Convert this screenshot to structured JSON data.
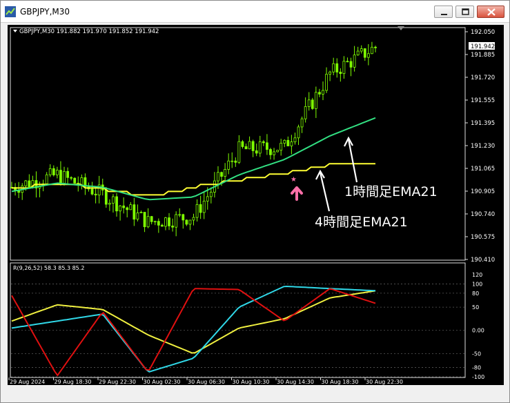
{
  "window": {
    "title": "GBPJPY,M30"
  },
  "main_chart": {
    "header_text": "GBPJPY,M30  191.882 191.970 191.852 191.942",
    "current_price_label": "191.942",
    "price_ticks": [
      "192.050",
      "191.885",
      "191.720",
      "191.555",
      "191.395",
      "191.230",
      "191.065",
      "190.905",
      "190.740",
      "190.575",
      "190.410"
    ],
    "annotation_1h": "1時間足EMA21",
    "annotation_4h": "4時間足EMA21"
  },
  "indicator": {
    "header_text": "R(9,26,52) 58.3 85.3 85.2",
    "ticks": [
      "120",
      "100",
      "80",
      "50",
      "0.00",
      "-50",
      "-80",
      "-100"
    ]
  },
  "time_axis": [
    "29 Aug 2024",
    "29 Aug 18:30",
    "29 Aug 22:30",
    "30 Aug 02:30",
    "30 Aug 06:30",
    "30 Aug 10:30",
    "30 Aug 14:30",
    "30 Aug 18:30",
    "30 Aug 22:30"
  ],
  "colors": {
    "candle": "#7fff00",
    "ema_1h": "#32e082",
    "ema_4h": "#ffff33",
    "line_red": "#e01010",
    "line_cyan": "#30d8e8",
    "line_yellow": "#f0f040",
    "arrow_marker": "#ff6fa8"
  },
  "chart_data": [
    {
      "type": "candlestick",
      "title": "GBPJPY,M30",
      "x": [
        "29 Aug 2024",
        "29 Aug 18:30",
        "29 Aug 22:30",
        "30 Aug 02:30",
        "30 Aug 06:30",
        "30 Aug 10:30",
        "30 Aug 14:30",
        "30 Aug 18:30",
        "30 Aug 22:30"
      ],
      "close_approx": [
        190.93,
        191.02,
        190.88,
        190.68,
        190.72,
        191.2,
        191.22,
        191.75,
        191.94
      ],
      "ylim": [
        190.41,
        192.05
      ],
      "series": [
        {
          "name": "1時間足EMA21",
          "values": [
            190.9,
            190.96,
            190.93,
            190.84,
            190.86,
            191.02,
            191.13,
            191.3,
            191.43
          ]
        },
        {
          "name": "4時間足EMA21",
          "values": [
            190.92,
            190.96,
            190.92,
            190.86,
            190.93,
            190.98,
            191.03,
            191.09,
            191.11
          ]
        }
      ]
    },
    {
      "type": "line",
      "title": "R(9,26,52) 58.3 85.3 85.2",
      "x": [
        "29 Aug 2024",
        "29 Aug 18:30",
        "29 Aug 22:30",
        "30 Aug 02:30",
        "30 Aug 06:30",
        "30 Aug 10:30",
        "30 Aug 14:30",
        "30 Aug 18:30",
        "30 Aug 22:30"
      ],
      "ylim": [
        -100,
        120
      ],
      "series": [
        {
          "values": [
            75,
            -98,
            40,
            -90,
            90,
            88,
            20,
            90,
            58.3
          ]
        },
        {
          "values": [
            5,
            20,
            35,
            -90,
            -60,
            50,
            95,
            90,
            85.3
          ]
        },
        {
          "values": [
            20,
            55,
            45,
            -10,
            -50,
            5,
            25,
            70,
            85.2
          ]
        }
      ]
    }
  ]
}
